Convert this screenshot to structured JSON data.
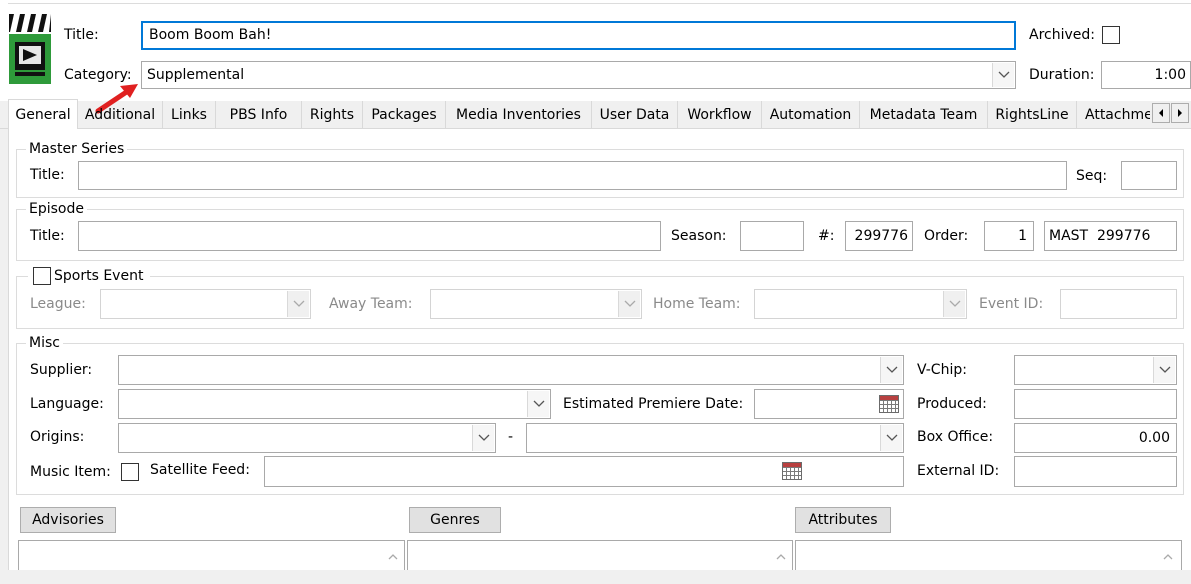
{
  "header": {
    "title_label": "Title:",
    "title_value": "Boom Boom Bah!",
    "archived_label": "Archived:",
    "category_label": "Category:",
    "category_value": "Supplemental",
    "duration_label": "Duration:",
    "duration_value": "1:00"
  },
  "tabs": [
    {
      "label": "General"
    },
    {
      "label": "Additional"
    },
    {
      "label": "Links"
    },
    {
      "label": "PBS Info"
    },
    {
      "label": "Rights"
    },
    {
      "label": "Packages"
    },
    {
      "label": "Media Inventories"
    },
    {
      "label": "User Data"
    },
    {
      "label": "Workflow"
    },
    {
      "label": "Automation"
    },
    {
      "label": "Metadata Team"
    },
    {
      "label": "RightsLine"
    },
    {
      "label": "Attachme"
    }
  ],
  "master_series": {
    "legend": "Master Series",
    "title_label": "Title:",
    "seq_label": "Seq:"
  },
  "episode": {
    "legend": "Episode",
    "title_label": "Title:",
    "season_label": "Season:",
    "number_label": "#:",
    "number_value": "299776",
    "order_label": "Order:",
    "order_value": "1",
    "code_value": "MAST  299776"
  },
  "sports": {
    "legend": "Sports Event",
    "league_label": "League:",
    "away_label": "Away Team:",
    "home_label": "Home Team:",
    "event_id_label": "Event ID:"
  },
  "misc": {
    "legend": "Misc",
    "supplier_label": "Supplier:",
    "vchip_label": "V-Chip:",
    "language_label": "Language:",
    "premiere_label": "Estimated Premiere Date:",
    "produced_label": "Produced:",
    "origins_label": "Origins:",
    "origins_sep": "-",
    "box_office_label": "Box Office:",
    "box_office_value": "0.00",
    "music_item_label": "Music Item:",
    "satellite_label": "Satellite Feed:",
    "external_id_label": "External ID:"
  },
  "buttons": {
    "advisories": "Advisories",
    "genres": "Genres",
    "attributes": "Attributes"
  },
  "colors": {
    "annotation_arrow": "#e02020",
    "title_focus_border": "#0078d7"
  }
}
